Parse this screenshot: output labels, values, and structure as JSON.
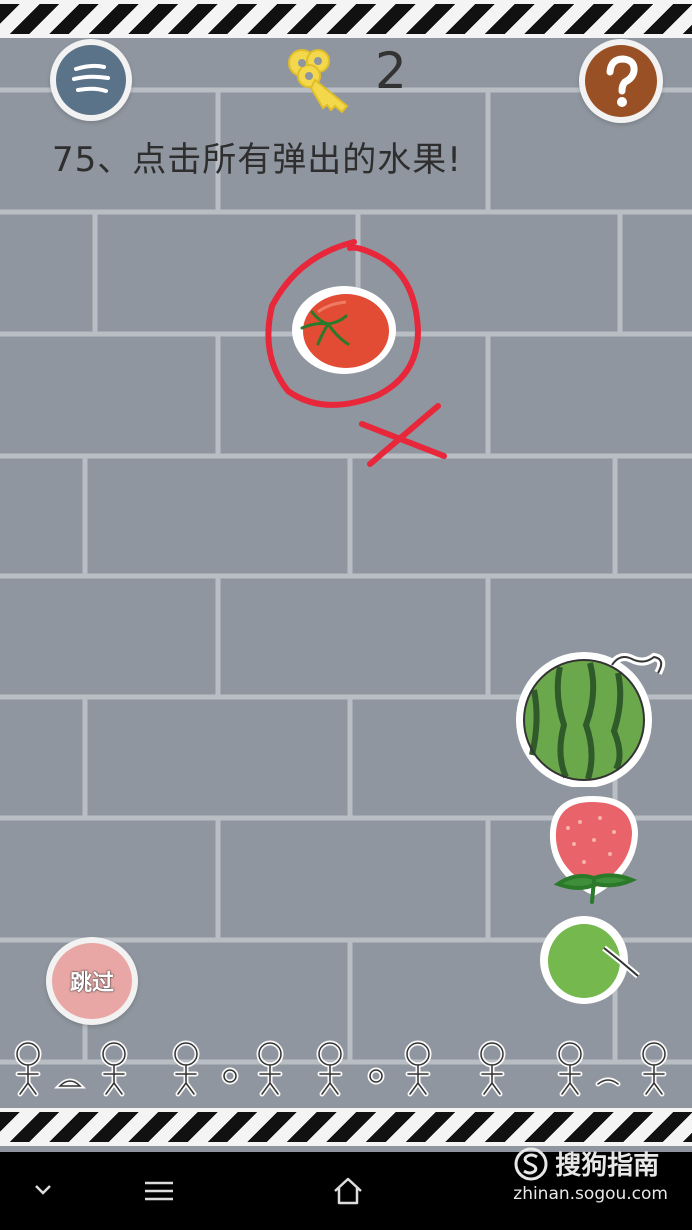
{
  "hud": {
    "key_count": "2",
    "level_text": "75、点击所有弹出的水果!",
    "skip_label": "跳过"
  },
  "icons": {
    "menu": "menu-icon",
    "key": "key-icon",
    "help": "question-icon"
  },
  "fruits": [
    "tomato",
    "watermelon",
    "strawberry",
    "green-plum"
  ],
  "annotation": {
    "mark": "red circle and cross around tomato"
  },
  "navbar": {
    "items": [
      "chevron-down-icon",
      "menu-lines-icon",
      "home-icon"
    ]
  },
  "watermark": {
    "name": "搜狗指南",
    "url": "zhinan.sogou.com"
  },
  "colors": {
    "wall": "#8f969f",
    "mortar": "#b9bec4",
    "annotation_red": "#e8273a"
  }
}
